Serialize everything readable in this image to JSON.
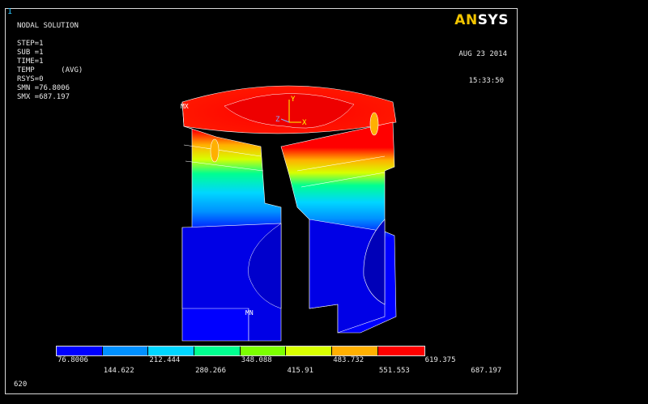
{
  "window_number": "1",
  "logo": {
    "an": "AN",
    "sys": "SYS"
  },
  "info_lines": [
    "NODAL SOLUTION",
    "",
    "STEP=1",
    "SUB =1",
    "TIME=1",
    "TEMP      (AVG)",
    "RSYS=0",
    "SMN =76.8006",
    "SMX =687.197"
  ],
  "date": "AUG 23 2014",
  "time": "15:33:50",
  "markers": {
    "mx": "MX",
    "mn": "MN",
    "axis_y": "Y",
    "axis_z": "Z",
    "axis_x": "X"
  },
  "legend": {
    "colors": [
      "#0000ff",
      "#0090ff",
      "#00d6ff",
      "#00ff90",
      "#7cff00",
      "#d8ff00",
      "#ffb000",
      "#ff0000"
    ],
    "top_labels": [
      "76.8006",
      "212.444",
      "348.088",
      "483.732",
      "619.375"
    ],
    "bottom_labels": [
      "144.622",
      "280.266",
      "415.91",
      "551.553",
      "687.197"
    ]
  },
  "bottom_tag": "620"
}
